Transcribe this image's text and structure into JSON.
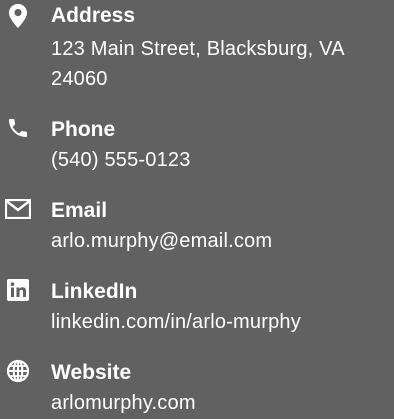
{
  "contacts": [
    {
      "label": "Address",
      "value": "123 Main Street, Blacksburg, VA 24060",
      "icon": "map-pin-icon"
    },
    {
      "label": "Phone",
      "value": "(540) 555-0123",
      "icon": "phone-icon"
    },
    {
      "label": "Email",
      "value": "arlo.murphy@email.com",
      "icon": "envelope-icon"
    },
    {
      "label": "LinkedIn",
      "value": "linkedin.com/in/arlo-murphy",
      "icon": "linkedin-icon"
    },
    {
      "label": "Website",
      "value": "arlomurphy.com",
      "icon": "globe-icon"
    }
  ]
}
